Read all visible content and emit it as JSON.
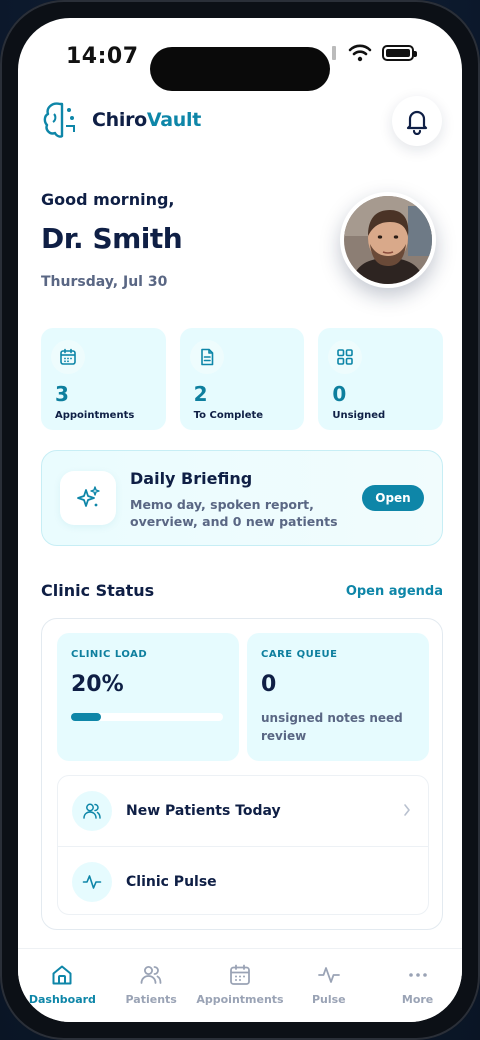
{
  "status_bar": {
    "time": "14:07"
  },
  "app": {
    "name_part1": "Chiro",
    "name_part2": "Vault"
  },
  "header": {
    "greeting": "Good morning,",
    "name": "Dr. Smith",
    "date": "Thursday, Jul 30"
  },
  "stats": [
    {
      "value": "3",
      "label": "Appointments",
      "icon": "calendar-icon"
    },
    {
      "value": "2",
      "label": "To Complete",
      "icon": "document-icon"
    },
    {
      "value": "0",
      "label": "Unsigned",
      "icon": "grid-icon"
    }
  ],
  "briefing": {
    "title": "Daily Briefing",
    "description": "Memo day, spoken report, overview, and 0 new patients",
    "button": "Open",
    "icon": "sparkles-icon"
  },
  "clinic_status": {
    "title": "Clinic Status",
    "link": "Open agenda",
    "load": {
      "label": "CLINIC LOAD",
      "value": "20%",
      "fraction": 0.2
    },
    "queue": {
      "label": "CARE QUEUE",
      "value": "0",
      "description": "unsigned notes need review"
    },
    "items": [
      {
        "label": "New Patients Today",
        "icon": "users-icon"
      },
      {
        "label": "Clinic Pulse",
        "icon": "pulse-icon"
      }
    ]
  },
  "tabs": [
    {
      "label": "Dashboard",
      "icon": "home-icon",
      "active": true
    },
    {
      "label": "Patients",
      "icon": "users-icon",
      "active": false
    },
    {
      "label": "Appointments",
      "icon": "calendar-icon",
      "active": false
    },
    {
      "label": "Pulse",
      "icon": "pulse-icon",
      "active": false
    },
    {
      "label": "More",
      "icon": "more-icon",
      "active": false
    }
  ],
  "colors": {
    "accent": "#0e86a8",
    "navy": "#0f1f45",
    "tile_bg": "#e6fbfe",
    "muted": "#5a6784"
  }
}
